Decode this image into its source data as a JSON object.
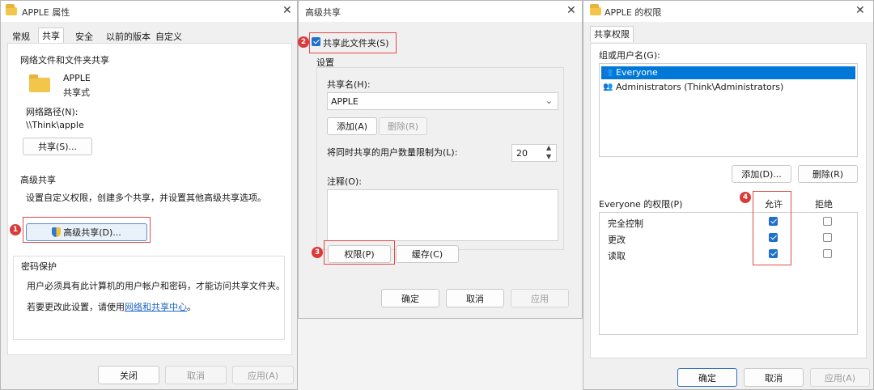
{
  "window1": {
    "title": "APPLE 属性",
    "tabs": [
      "常规",
      "共享",
      "安全",
      "以前的版本",
      "自定义"
    ],
    "net_share_group": "网络文件和文件夹共享",
    "folder_name": "APPLE",
    "folder_status": "共享式",
    "net_path_label": "网络路径(N):",
    "net_path_value": "\\\\Think\\apple",
    "share_button": "共享(S)...",
    "adv_group": "高级共享",
    "adv_desc": "设置自定义权限，创建多个共享，并设置其他高级共享选项。",
    "adv_button": "高级共享(D)...",
    "pw_group": "密码保护",
    "pw_desc": "用户必须具有此计算机的用户帐户和密码，才能访问共享文件夹。",
    "pw_change_prefix": "若要更改此设置，请使用",
    "pw_link": "网络和共享中心",
    "pw_change_suffix": "。",
    "close_button": "关闭",
    "cancel_button": "取消",
    "apply_button": "应用(A)"
  },
  "window2": {
    "title": "高级共享",
    "share_checkbox": "共享此文件夹(S)",
    "settings_group": "设置",
    "share_name_label": "共享名(H):",
    "share_name_value": "APPLE",
    "add_button": "添加(A)",
    "remove_button": "删除(R)",
    "limit_label": "将同时共享的用户数量限制为(L):",
    "limit_value": "20",
    "comment_label": "注释(O):",
    "perm_button": "权限(P)",
    "cache_button": "缓存(C)",
    "ok_button": "确定",
    "cancel_button": "取消",
    "apply_button": "应用"
  },
  "window3": {
    "title": "APPLE 的权限",
    "tab": "共享权限",
    "group_label": "组或用户名(G):",
    "users": [
      "Everyone",
      "Administrators (Think\\Administrators)"
    ],
    "add_button": "添加(D)...",
    "remove_button": "删除(R)",
    "perm_header": "Everyone 的权限(P)",
    "allow_header": "允许",
    "deny_header": "拒绝",
    "permissions": [
      {
        "name": "完全控制",
        "allow": true,
        "deny": false
      },
      {
        "name": "更改",
        "allow": true,
        "deny": false
      },
      {
        "name": "读取",
        "allow": true,
        "deny": false
      }
    ],
    "ok_button": "确定",
    "cancel_button": "取消",
    "apply_button": "应用(A)"
  },
  "markers": [
    "1",
    "2",
    "3",
    "4"
  ],
  "colors": {
    "accent": "#1f6fcc",
    "highlight_box": "#e34a4a",
    "marker": "#d93a3a",
    "selection": "#0078d7"
  }
}
